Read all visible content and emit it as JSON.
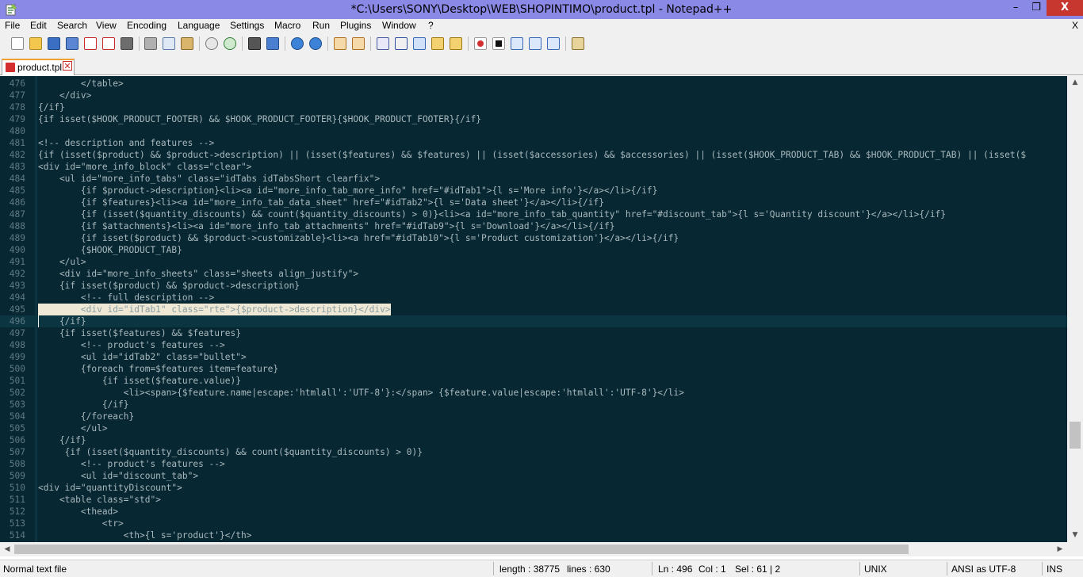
{
  "window": {
    "title": "*C:\\Users\\SONY\\Desktop\\WEB\\SHOPINTIMO\\product.tpl - Notepad++",
    "min_glyph": "–",
    "max_glyph": "❐",
    "close_glyph": "X"
  },
  "menu": {
    "items": [
      "File",
      "Edit",
      "Search",
      "View",
      "Encoding",
      "Language",
      "Settings",
      "Macro",
      "Run",
      "Plugins",
      "Window",
      "?"
    ],
    "close_x": "X"
  },
  "toolbar": {
    "icons": [
      "new-file-icon",
      "open-file-icon",
      "save-icon",
      "save-all-icon",
      "close-icon",
      "close-all-icon",
      "print-icon",
      "cut-icon",
      "copy-icon",
      "paste-icon",
      "undo-icon",
      "redo-icon",
      "find-icon",
      "replace-icon",
      "zoom-in-icon",
      "zoom-out-icon",
      "sync-vertical-icon",
      "sync-horizontal-icon",
      "word-wrap-icon",
      "show-all-chars-icon",
      "indent-guide-icon",
      "doc-map-icon",
      "function-list-icon",
      "record-macro-icon",
      "stop-record-icon",
      "play-macro-icon",
      "run-macro-multiple-icon",
      "save-macro-icon",
      "launch-browser-icon"
    ]
  },
  "tab": {
    "label": "product.tpl",
    "close_glyph": "✕"
  },
  "editor": {
    "caret_line": 496,
    "selected_line": 495,
    "lines": [
      {
        "n": "476",
        "t": "        </table>"
      },
      {
        "n": "477",
        "t": "    </div>"
      },
      {
        "n": "478",
        "t": "{/if}"
      },
      {
        "n": "479",
        "t": "{if isset($HOOK_PRODUCT_FOOTER) && $HOOK_PRODUCT_FOOTER}{$HOOK_PRODUCT_FOOTER}{/if}"
      },
      {
        "n": "480",
        "t": ""
      },
      {
        "n": "481",
        "t": "<!-- description and features -->"
      },
      {
        "n": "482",
        "t": "{if (isset($product) && $product->description) || (isset($features) && $features) || (isset($accessories) && $accessories) || (isset($HOOK_PRODUCT_TAB) && $HOOK_PRODUCT_TAB) || (isset($"
      },
      {
        "n": "483",
        "t": "<div id=\"more_info_block\" class=\"clear\">"
      },
      {
        "n": "484",
        "t": "    <ul id=\"more_info_tabs\" class=\"idTabs idTabsShort clearfix\">"
      },
      {
        "n": "485",
        "t": "        {if $product->description}<li><a id=\"more_info_tab_more_info\" href=\"#idTab1\">{l s='More info'}</a></li>{/if}"
      },
      {
        "n": "486",
        "t": "        {if $features}<li><a id=\"more_info_tab_data_sheet\" href=\"#idTab2\">{l s='Data sheet'}</a></li>{/if}"
      },
      {
        "n": "487",
        "t": "        {if (isset($quantity_discounts) && count($quantity_discounts) > 0)}<li><a id=\"more_info_tab_quantity\" href=\"#discount_tab\">{l s='Quantity discount'}</a></li>{/if}"
      },
      {
        "n": "488",
        "t": "        {if $attachments}<li><a id=\"more_info_tab_attachments\" href=\"#idTab9\">{l s='Download'}</a></li>{/if}"
      },
      {
        "n": "489",
        "t": "        {if isset($product) && $product->customizable}<li><a href=\"#idTab10\">{l s='Product customization'}</a></li>{/if}"
      },
      {
        "n": "490",
        "t": "        {$HOOK_PRODUCT_TAB}"
      },
      {
        "n": "491",
        "t": "    </ul>"
      },
      {
        "n": "492",
        "t": "    <div id=\"more_info_sheets\" class=\"sheets align_justify\">"
      },
      {
        "n": "493",
        "t": "    {if isset($product) && $product->description}"
      },
      {
        "n": "494",
        "t": "        <!-- full description -->"
      },
      {
        "n": "495",
        "t": "        <div id=\"idTab1\" class=\"rte\">{$product->description}</div>"
      },
      {
        "n": "496",
        "t": "    {/if}"
      },
      {
        "n": "497",
        "t": "    {if isset($features) && $features}"
      },
      {
        "n": "498",
        "t": "        <!-- product's features -->"
      },
      {
        "n": "499",
        "t": "        <ul id=\"idTab2\" class=\"bullet\">"
      },
      {
        "n": "500",
        "t": "        {foreach from=$features item=feature}"
      },
      {
        "n": "501",
        "t": "            {if isset($feature.value)}"
      },
      {
        "n": "502",
        "t": "                <li><span>{$feature.name|escape:'htmlall':'UTF-8'}:</span> {$feature.value|escape:'htmlall':'UTF-8'}</li>"
      },
      {
        "n": "503",
        "t": "            {/if}"
      },
      {
        "n": "504",
        "t": "        {/foreach}"
      },
      {
        "n": "505",
        "t": "        </ul>"
      },
      {
        "n": "506",
        "t": "    {/if}"
      },
      {
        "n": "507",
        "t": "     {if (isset($quantity_discounts) && count($quantity_discounts) > 0)}"
      },
      {
        "n": "508",
        "t": "        <!-- product's features -->"
      },
      {
        "n": "509",
        "t": "        <ul id=\"discount_tab\">"
      },
      {
        "n": "510",
        "t": "<div id=\"quantityDiscount\">"
      },
      {
        "n": "511",
        "t": "    <table class=\"std\">"
      },
      {
        "n": "512",
        "t": "        <thead>"
      },
      {
        "n": "513",
        "t": "            <tr>"
      },
      {
        "n": "514",
        "t": "                <th>{l s='product'}</th>"
      }
    ]
  },
  "scroll": {
    "up_glyph": "▲",
    "down_glyph": "▼",
    "left_glyph": "◀",
    "right_glyph": "▶"
  },
  "status": {
    "file_type": "Normal text file",
    "length": "length : 38775",
    "lines": "lines : 630",
    "ln": "Ln : 496",
    "col": "Col : 1",
    "sel": "Sel : 61 | 2",
    "eol": "UNIX",
    "encoding": "ANSI as UTF-8",
    "mode": "INS"
  },
  "colors": {
    "editor_bg": "#072733",
    "text": "#a9b9bd",
    "line_number": "#5f7a85",
    "selection": "#eee8d5",
    "title_bar": "#8a89e6"
  }
}
